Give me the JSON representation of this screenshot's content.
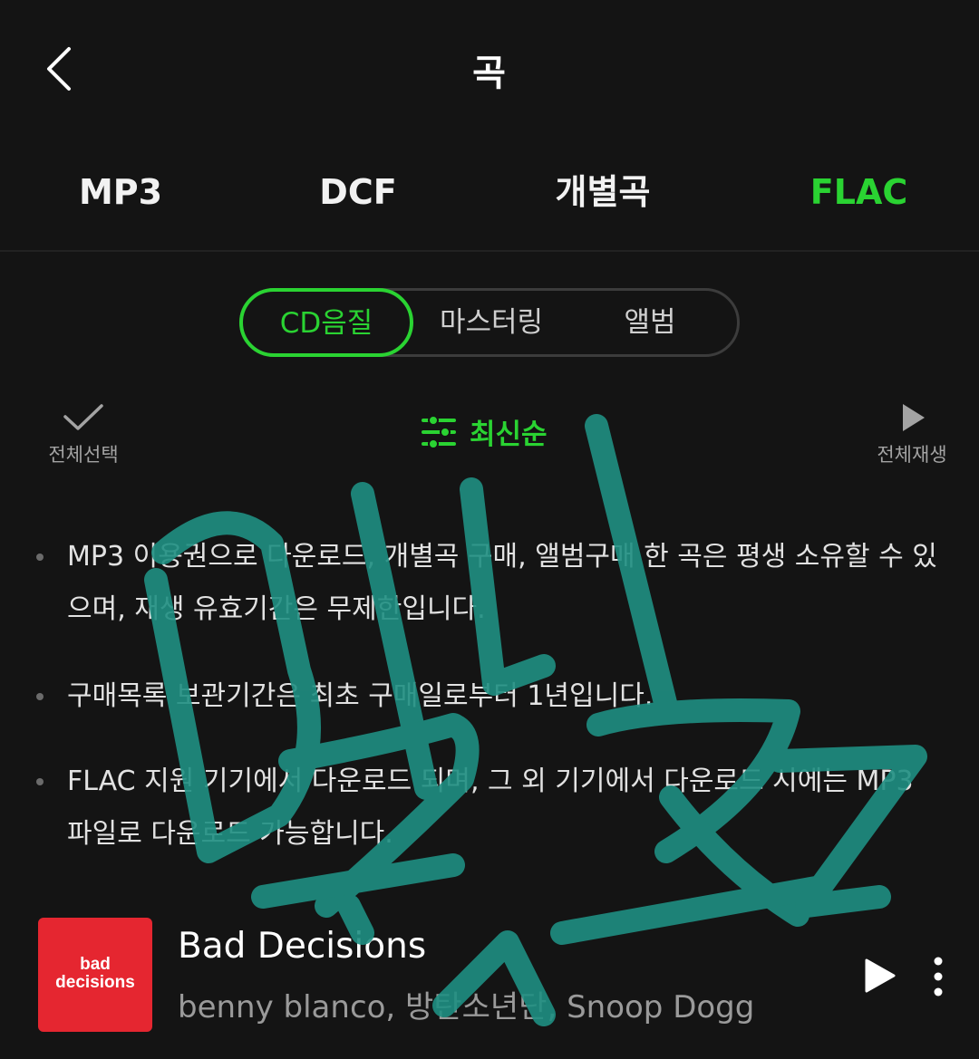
{
  "header": {
    "title": "곡",
    "back_icon": "chevron-left-icon"
  },
  "format_tabs": [
    {
      "label": "MP3",
      "active": false
    },
    {
      "label": "DCF",
      "active": false
    },
    {
      "label": "개별곡",
      "active": false
    },
    {
      "label": "FLAC",
      "active": true
    }
  ],
  "quality_segment": [
    {
      "label": "CD음질",
      "active": true
    },
    {
      "label": "마스터링",
      "active": false
    },
    {
      "label": "앨범",
      "active": false
    }
  ],
  "toolbar": {
    "select_all_label": "전체선택",
    "select_all_icon": "checkmark-icon",
    "sort_label": "최신순",
    "sort_icon": "sliders-icon",
    "play_all_label": "전체재생",
    "play_all_icon": "play-icon"
  },
  "notices": [
    "MP3 이용권으로 다운로드, 개별곡 구매, 앨범구매 한 곡은 평생 소유할 수 있으며, 재생 유효기간은 무제한입니다.",
    "구매목록 보관기간은 최초 구매일로부터 1년입니다.",
    "FLAC 지원 기기에서 다운로드 되며, 그 외 기기에서 다운로드 시에는 MP3 파일로 다운로드 가능합니다."
  ],
  "song": {
    "title": "Bad Decisions",
    "artist": "benny blanco, 방탄소년단, Snoop Dogg",
    "cover_text_line1": "bad",
    "cover_text_line2": "decisions",
    "cover_color": "#e52630",
    "play_icon": "play-icon",
    "more_icon": "more-vertical-icon"
  },
  "colors": {
    "accent": "#2ad332",
    "background": "#141414",
    "handwriting": "#1f8f82"
  },
  "handwriting_text": "미니 굿즈"
}
